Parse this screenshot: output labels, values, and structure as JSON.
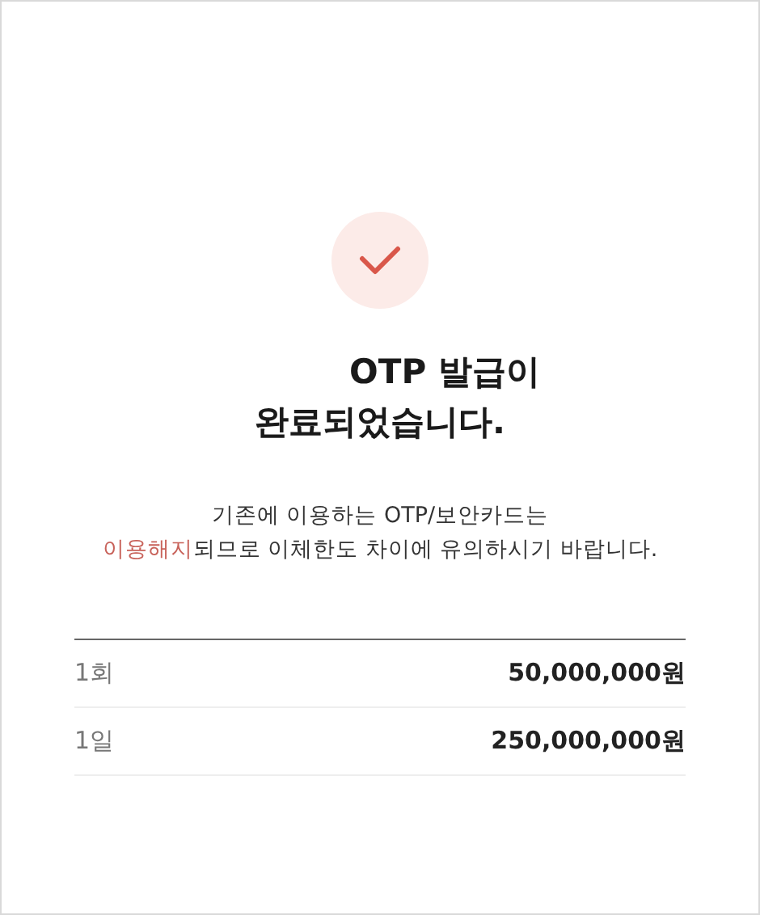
{
  "status_icon": {
    "kind": "check"
  },
  "title_lines": [
    "OTP 발급이",
    "완료되었습니다."
  ],
  "notice": {
    "line_1": "기존에 이용하는 OTP/보안카드는",
    "highlight": "이용해지",
    "line_2_rest": "되므로 이체한도 차이에 유의하시기 바랍니다."
  },
  "limits": [
    {
      "label": "1회",
      "value": "50,000,000원"
    },
    {
      "label": "1일",
      "value": "250,000,000원"
    }
  ]
}
